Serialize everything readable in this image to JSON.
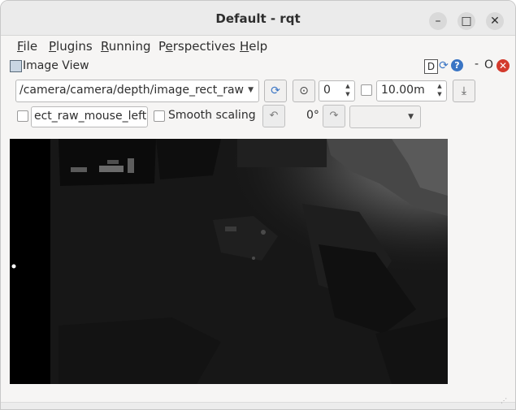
{
  "window": {
    "title": "Default - rqt",
    "controls": {
      "minimize": "–",
      "maximize": "□",
      "close": "✕"
    }
  },
  "menu": {
    "items": [
      {
        "first": "F",
        "rest": "ile"
      },
      {
        "first": "P",
        "rest": "lugins"
      },
      {
        "first": "R",
        "rest": "unning"
      },
      {
        "first": "P",
        "pre": "",
        "rest": "erspectives",
        "underline_index": 1
      },
      {
        "first": "H",
        "rest": "elp"
      }
    ],
    "labels": [
      "File",
      "Plugins",
      "Running",
      "Perspectives",
      "Help"
    ]
  },
  "dock": {
    "title": "Image View",
    "d_label": "D",
    "help_label": "?",
    "minimize_label": "-",
    "float_label": "O",
    "close_label": "✕"
  },
  "toolbar": {
    "topic_select": "/camera/camera/depth/image_rect_raw",
    "refresh_icon": "refresh-icon",
    "zoom_icon": "zoom-fit-icon",
    "zoom_value": "0",
    "max_depth_value": "10.00m",
    "save_icon": "save-icon"
  },
  "toolbar2": {
    "mouse_topic_value": "ect_raw_mouse_left",
    "smooth_scaling_label": "Smooth scaling",
    "rotation_label": "0°",
    "colormap_value": ""
  },
  "colors": {
    "accent": "#3a75c4",
    "close_red": "#d33a2c",
    "image_bg": "#151515"
  }
}
